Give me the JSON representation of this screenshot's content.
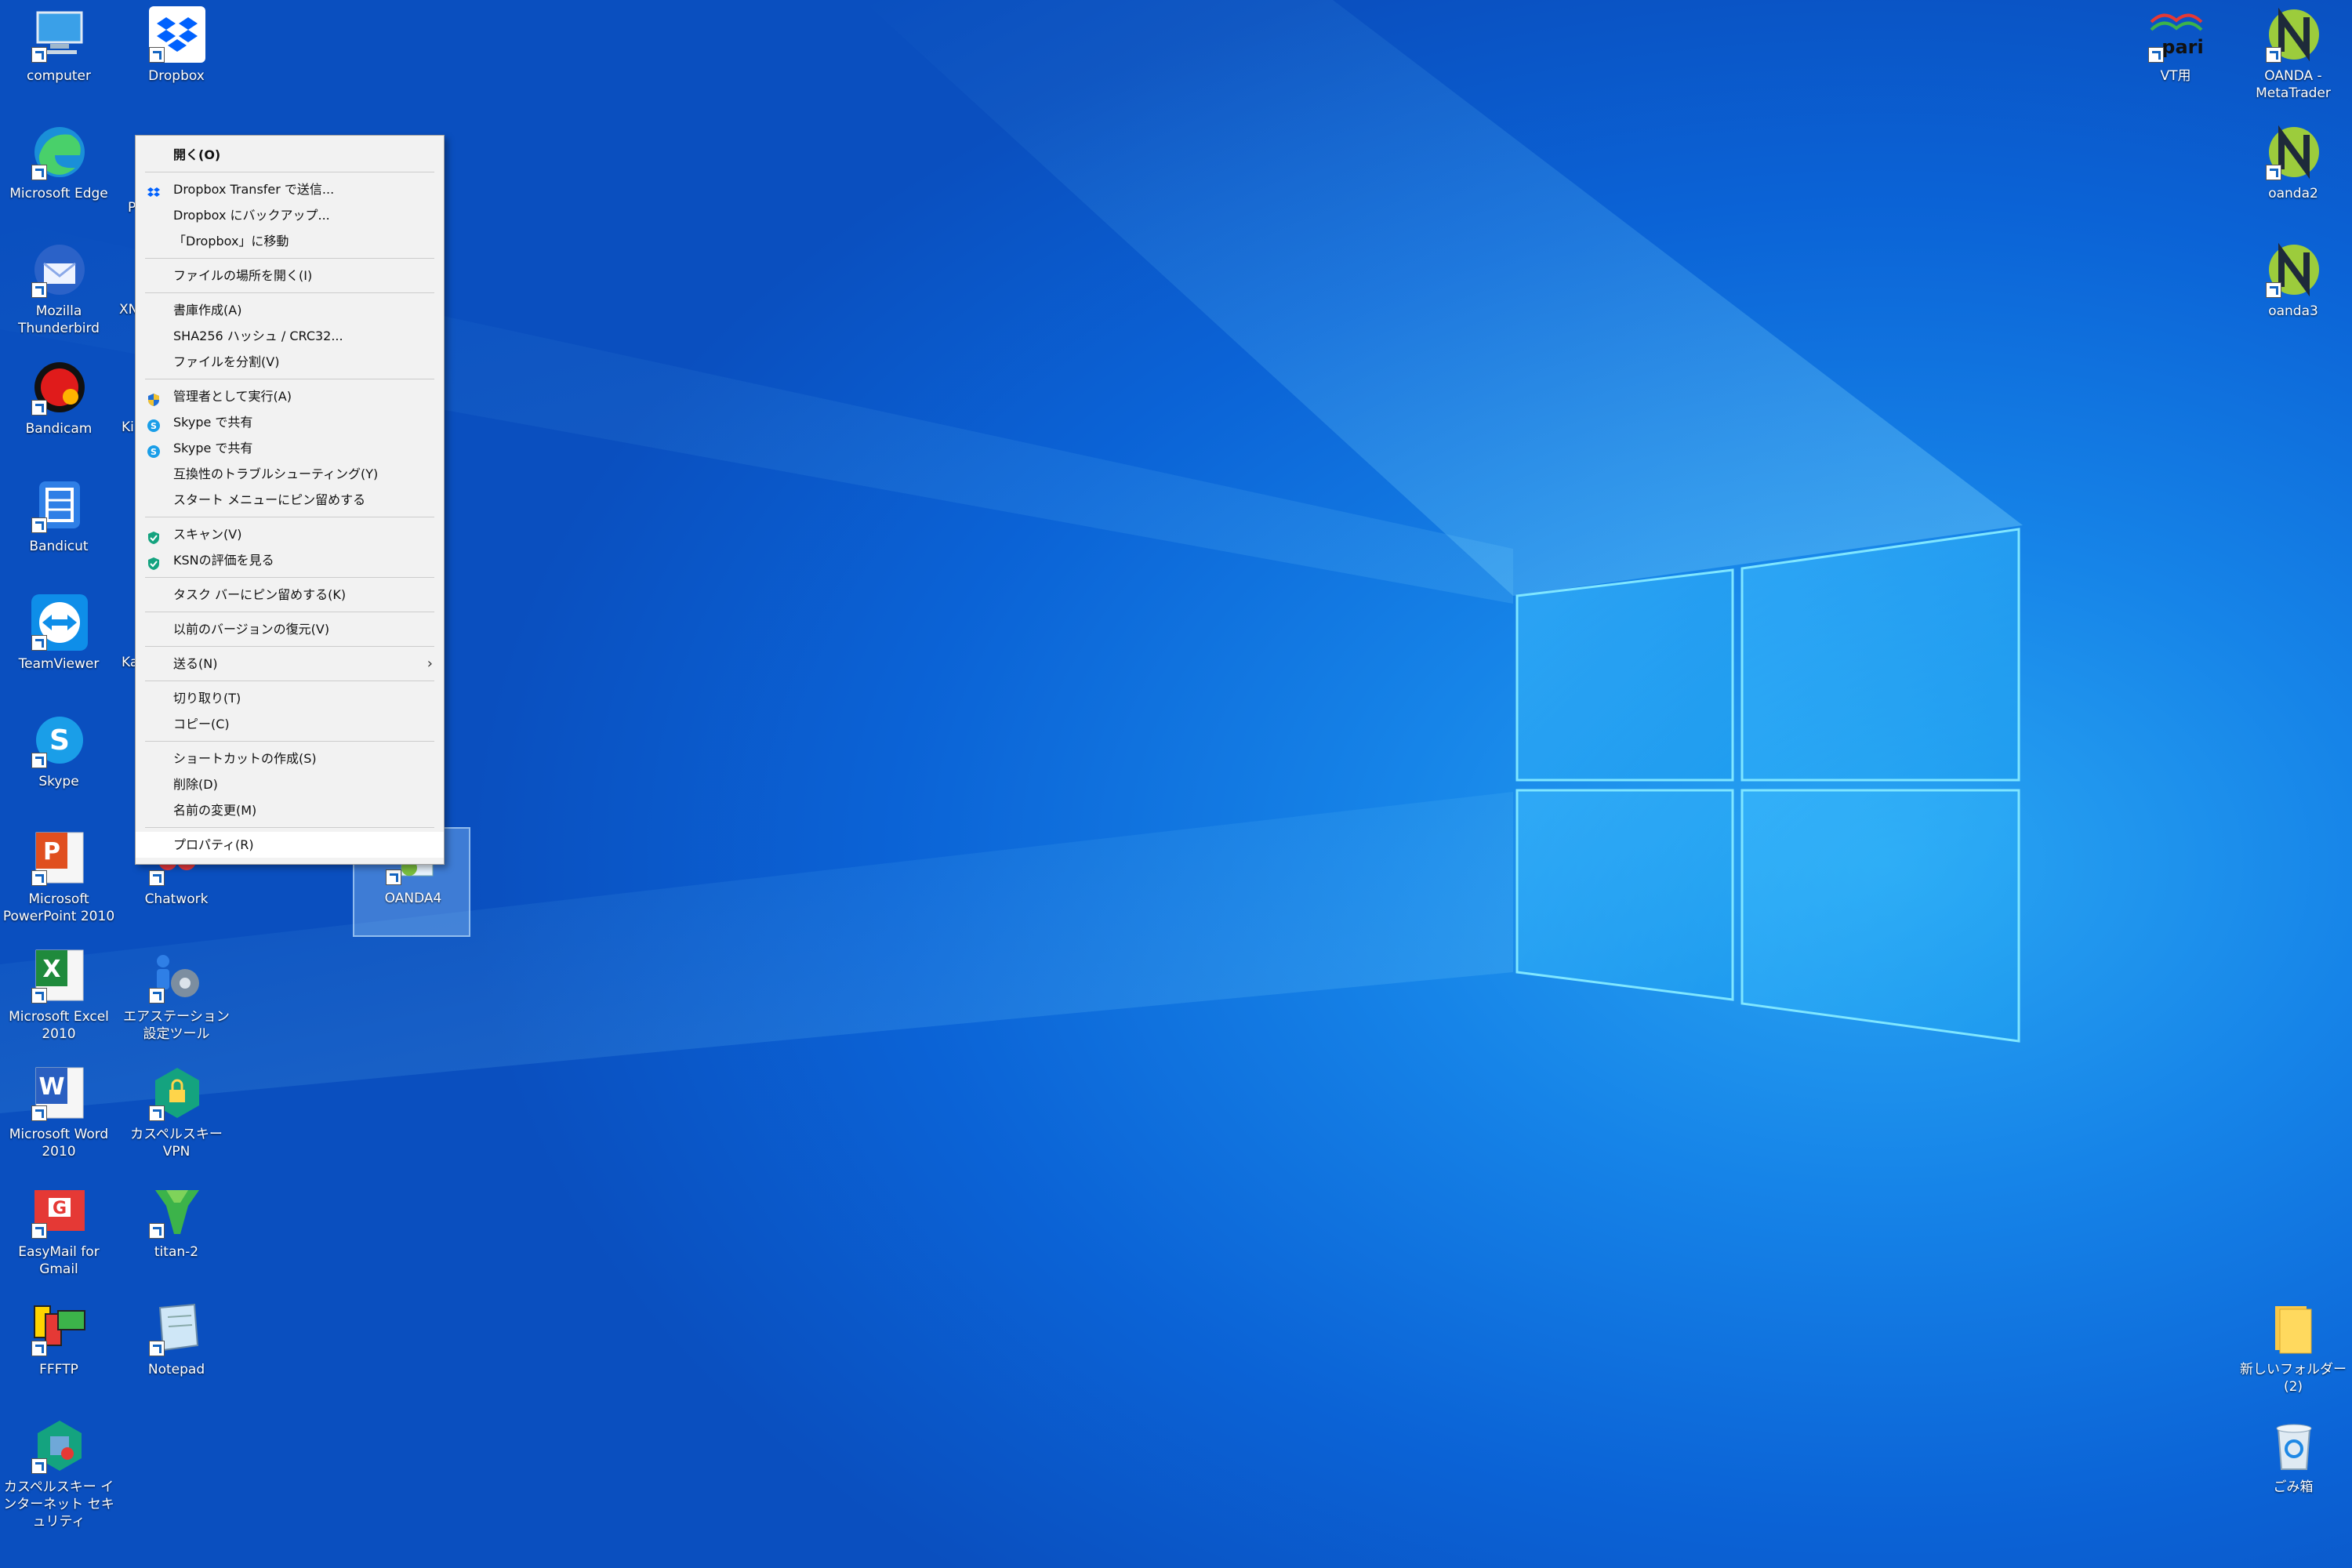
{
  "desktop": {
    "left_icons": [
      {
        "label": "computer",
        "icon": "computer-icon"
      },
      {
        "label": "Dropbox",
        "icon": "dropbox-icon"
      },
      {
        "label": "Microsoft Edge",
        "icon": "edge-icon"
      },
      {
        "label": "Mozilla Thunderbird",
        "icon": "thunderbird-icon"
      },
      {
        "label": "Bandicam",
        "icon": "bandicam-icon"
      },
      {
        "label": "Bandicut",
        "icon": "bandicut-icon"
      },
      {
        "label": "TeamViewer",
        "icon": "teamviewer-icon"
      },
      {
        "label": "Skype",
        "icon": "skype-icon"
      },
      {
        "label": "Microsoft PowerPoint 2010",
        "icon": "powerpoint-icon"
      },
      {
        "label": "Chatwork",
        "icon": "chatwork-icon"
      },
      {
        "label": "OANDA4",
        "icon": "oanda-icon"
      },
      {
        "label": "Microsoft Excel 2010",
        "icon": "excel-icon"
      },
      {
        "label": "エアステーション設定ツール",
        "icon": "airstation-icon"
      },
      {
        "label": "Microsoft Word 2010",
        "icon": "word-icon"
      },
      {
        "label": "カスペルスキー VPN",
        "icon": "kaspersky-vpn-icon"
      },
      {
        "label": "EasyMail for Gmail",
        "icon": "easymail-icon"
      },
      {
        "label": "titan-2",
        "icon": "titan-icon"
      },
      {
        "label": "FFFTP",
        "icon": "ffftp-icon"
      },
      {
        "label": "Notepad",
        "icon": "notepad-icon"
      },
      {
        "label": "カスペルスキー インターネット セキュリティ",
        "icon": "kaspersky-icon"
      }
    ],
    "right_icons": [
      {
        "label": "VT用",
        "icon": "pari-icon",
        "logo_text": "pari"
      },
      {
        "label": "OANDA - MetaTrader",
        "icon": "oanda-metatrader-icon"
      },
      {
        "label": "oanda2",
        "icon": "oanda2-icon"
      },
      {
        "label": "oanda3",
        "icon": "oanda3-icon"
      },
      {
        "label": "新しいフォルダー (2)",
        "icon": "folder-icon"
      },
      {
        "label": "ごみ箱",
        "icon": "recycle-bin-icon"
      }
    ],
    "partial_labels": [
      "P",
      "XN",
      "Ki",
      "Ka"
    ]
  },
  "context_menu": {
    "groups": [
      [
        {
          "label": "開く(O)",
          "icon": ""
        }
      ],
      [
        {
          "label": "Dropbox Transfer で送信...",
          "icon": "dropbox-icon"
        },
        {
          "label": "Dropbox にバックアップ...",
          "icon": ""
        },
        {
          "label": "「Dropbox」に移動",
          "icon": ""
        }
      ],
      [
        {
          "label": "ファイルの場所を開く(I)",
          "icon": ""
        }
      ],
      [
        {
          "label": "書庫作成(A)",
          "icon": ""
        },
        {
          "label": "SHA256 ハッシュ / CRC32...",
          "icon": ""
        },
        {
          "label": "ファイルを分割(V)",
          "icon": ""
        }
      ],
      [
        {
          "label": "管理者として実行(A)",
          "icon": "uac-shield-icon"
        },
        {
          "label": "Skype で共有",
          "icon": "skype-icon"
        },
        {
          "label": "Skype で共有",
          "icon": "skype-icon"
        },
        {
          "label": "互換性のトラブルシューティング(Y)",
          "icon": ""
        },
        {
          "label": "スタート メニューにピン留めする",
          "icon": ""
        }
      ],
      [
        {
          "label": "スキャン(V)",
          "icon": "kaspersky-shield-icon"
        },
        {
          "label": "KSNの評価を見る",
          "icon": "kaspersky-shield-icon"
        }
      ],
      [
        {
          "label": "タスク バーにピン留めする(K)",
          "icon": ""
        }
      ],
      [
        {
          "label": "以前のバージョンの復元(V)",
          "icon": ""
        }
      ],
      [
        {
          "label": "送る(N)",
          "icon": "",
          "submenu": true
        }
      ],
      [
        {
          "label": "切り取り(T)",
          "icon": ""
        },
        {
          "label": "コピー(C)",
          "icon": ""
        }
      ],
      [
        {
          "label": "ショートカットの作成(S)",
          "icon": ""
        },
        {
          "label": "削除(D)",
          "icon": ""
        },
        {
          "label": "名前の変更(M)",
          "icon": ""
        }
      ],
      [
        {
          "label": "プロパティ(R)",
          "icon": ""
        }
      ]
    ],
    "submenu_arrow": "›"
  },
  "colors": {
    "menu_bg": "#f2f2f2",
    "desktop_blue": "#0b63d6",
    "glow": "#4fd2ff"
  }
}
